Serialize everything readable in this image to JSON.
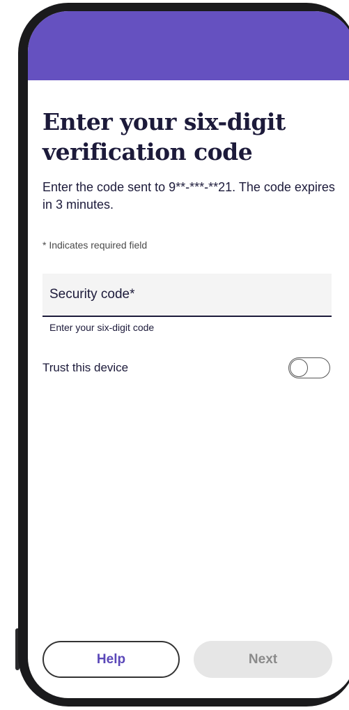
{
  "header": {
    "title": "Enter your six-digit verification code",
    "description": "Enter the code sent to 9**-***-**21. The code expires in 3 minutes."
  },
  "form": {
    "required_note": "* Indicates required field",
    "code_field": {
      "label": "Security code*",
      "value": "",
      "helper": "Enter your six-digit code"
    },
    "trust_device": {
      "label": "Trust this device",
      "enabled": false
    }
  },
  "footer": {
    "help_label": "Help",
    "next_label": "Next",
    "next_enabled": false
  },
  "colors": {
    "accent": "#6551c0",
    "button_text": "#5a47b8",
    "text": "#1c1a3a",
    "disabled_bg": "#e6e6e6"
  }
}
